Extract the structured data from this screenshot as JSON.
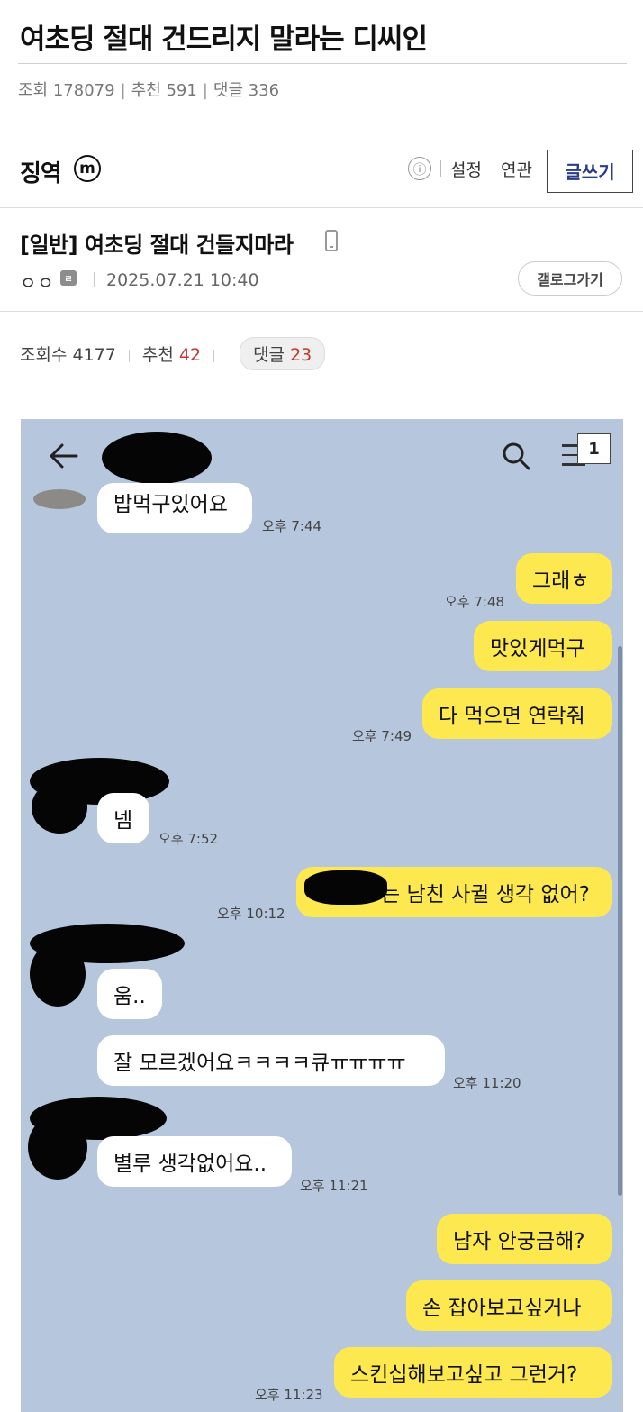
{
  "post": {
    "title": "여초딩 절대 건드리지 말라는 디씨인",
    "views_label": "조회 178079",
    "recommend_label": "추천 591",
    "comments_label": "댓글 336",
    "separator": "|"
  },
  "gallery": {
    "name": "징역",
    "minor_badge": "m",
    "info_icon": "ⓘ",
    "settings": "설정",
    "related": "연관",
    "write": "글쓰기"
  },
  "article": {
    "title": "[일반] 여초딩 절대 건들지마라",
    "author": "ㅇㅇ",
    "author_badge": "ㄹ",
    "date": "2025.07.21 10:40",
    "back_to_gallery": "갤로그가기",
    "views_label": "조회수",
    "views": "4177",
    "recommend_label": "추천",
    "recommend": "42",
    "comments_label": "댓글",
    "comments": "23"
  },
  "chat": {
    "page_badge": "1",
    "messages": [
      {
        "side": "in",
        "text": "밥먹구있어요",
        "time": "오후 7:44"
      },
      {
        "side": "out",
        "text": "그래ㅎ",
        "time": "오후 7:48"
      },
      {
        "side": "out",
        "text": "맛있게먹구",
        "time": ""
      },
      {
        "side": "out",
        "text": "다 먹으면 연락줘",
        "time": "오후 7:49"
      },
      {
        "side": "in",
        "text": "넴",
        "time": "오후 7:52"
      },
      {
        "side": "out",
        "text": "는 남친 사귈 생각 없어?",
        "time": "오후 10:12"
      },
      {
        "side": "in",
        "text": "움..",
        "time": ""
      },
      {
        "side": "in",
        "text": "잘 모르겠어요ㅋㅋㅋㅋ큐ㅠㅠㅠㅠ",
        "time": "오후 11:20"
      },
      {
        "side": "in",
        "text": "별루 생각없어요..",
        "time": "오후 11:21"
      },
      {
        "side": "out",
        "text": "남자 안궁금해?",
        "time": ""
      },
      {
        "side": "out",
        "text": "손 잡아보고싶거나",
        "time": ""
      },
      {
        "side": "out",
        "text": "스킨십해보고싶고 그런거?",
        "time": "오후 11:23"
      }
    ]
  },
  "colors": {
    "chat_background": "#b5c6dd",
    "outgoing_bubble": "#fde94f",
    "incoming_bubble": "#ffffff",
    "write_button_text": "#2b3c8c",
    "count_red": "#c0392b"
  },
  "icons": [
    "back-arrow-icon",
    "search-icon",
    "menu-icon",
    "info-icon",
    "mobile-icon"
  ]
}
